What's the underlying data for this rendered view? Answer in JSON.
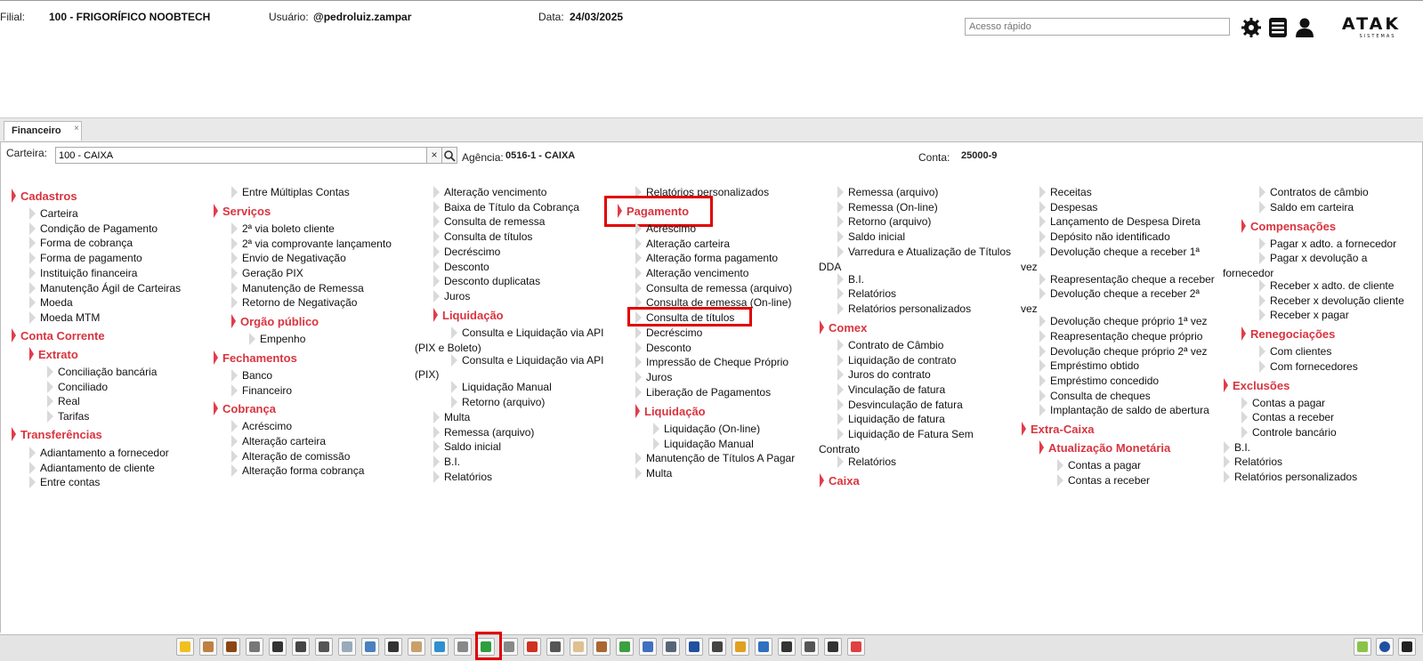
{
  "header": {
    "filial_label": "Filial:",
    "filial_value": "100 - FRIGORÍFICO NOOBTECH",
    "usuario_label": "Usuário:",
    "usuario_value": "@pedroluiz.zampar",
    "data_label": "Data:",
    "data_value": "24/03/2025",
    "quick_access_placeholder": "Acesso rápido",
    "logo_text": "ATAK",
    "logo_subtext": "SISTEMAS"
  },
  "tab": {
    "label": "Financeiro",
    "close": "×"
  },
  "filters": {
    "carteira_label": "Carteira:",
    "carteira_value": "100 - CAIXA",
    "clear": "×",
    "agencia_label": "Agência:",
    "agencia_value": "0516-1 - CAIXA",
    "conta_label": "Conta:",
    "conta_value": "25000-9"
  },
  "col1": {
    "cadastros": "Cadastros",
    "cadastros_items": [
      "Carteira",
      "Condição de Pagamento",
      "Forma de cobrança",
      "Forma de pagamento",
      "Instituição financeira",
      "Manutenção Ágil de Carteiras",
      "Moeda",
      "Moeda MTM"
    ],
    "conta_corrente": "Conta Corrente",
    "extrato": "Extrato",
    "extrato_items": [
      "Conciliação bancária",
      "Conciliado",
      "Real",
      "Tarifas"
    ],
    "transferencias": "Transferências",
    "transferencias_items": [
      "Adiantamento a fornecedor",
      "Adiantamento de cliente",
      "Entre contas"
    ]
  },
  "col2": {
    "top_item": "Entre Múltiplas Contas",
    "servicos": "Serviços",
    "servicos_items": [
      "2ª via boleto cliente",
      "2ª via comprovante lançamento",
      "Envio de Negativação",
      "Geração PIX",
      "Manutenção de Remessa",
      "Retorno de Negativação"
    ],
    "orgao_publico": "Orgão público",
    "orgao_items": [
      "Empenho"
    ],
    "fechamentos": "Fechamentos",
    "fechamentos_items": [
      "Banco",
      "Financeiro"
    ],
    "cobranca": "Cobrança",
    "cobranca_items": [
      "Acréscimo",
      "Alteração carteira",
      "Alteração de comissão",
      "Alteração forma cobrança"
    ]
  },
  "col3": {
    "items_top": [
      "Alteração vencimento",
      "Baixa de Título da Cobrança",
      "Consulta de remessa",
      "Consulta de títulos",
      "Decréscimo",
      "Desconto",
      "Desconto duplicatas",
      "Juros"
    ],
    "liquidacao": "Liquidação",
    "liq_api_pix_1": "Consulta e Liquidação via API",
    "liq_api_pix_2": "(PIX e Boleto)",
    "liq_api_1": "Consulta e Liquidação via API",
    "liq_api_2": "(PIX)",
    "liq_items": [
      "Liquidação Manual",
      "Retorno (arquivo)"
    ],
    "items_bottom": [
      "Multa",
      "Remessa (arquivo)",
      "Saldo inicial",
      "B.I.",
      "Relatórios"
    ]
  },
  "col4": {
    "top_item": "Relatórios personalizados",
    "pagamento": "Pagamento",
    "pagamento_items": [
      "Acréscimo",
      "Alteração carteira",
      "Alteração forma pagamento",
      "Alteração vencimento",
      "Consulta de remessa (arquivo)",
      "Consulta de remessa (On-line)",
      "Consulta de títulos",
      "Decréscimo",
      "Desconto",
      "Impressão de Cheque Próprio",
      "Juros",
      "Liberação de Pagamentos"
    ],
    "liquidacao": "Liquidação",
    "liq_items": [
      "Liquidação (On-line)",
      "Liquidação Manual"
    ],
    "bottom_items": [
      "Manutenção de Títulos A Pagar",
      "Multa"
    ]
  },
  "col5": {
    "items_top": [
      "Remessa (arquivo)",
      "Remessa (On-line)",
      "Retorno (arquivo)",
      "Saldo inicial"
    ],
    "varredura_1": "Varredura e Atualização de Títulos",
    "varredura_2": "DDA",
    "items_mid": [
      "B.I.",
      "Relatórios",
      "Relatórios personalizados"
    ],
    "comex": "Comex",
    "comex_items": [
      "Contrato de Câmbio",
      "Liquidação de contrato",
      "Juros do contrato",
      "Vinculação de fatura",
      "Desvinculação de fatura",
      "Liquidação de fatura"
    ],
    "liq_sem_1": "Liquidação de Fatura Sem",
    "liq_sem_2": "Contrato",
    "comex_last": "Relatórios",
    "caixa": "Caixa"
  },
  "col6": {
    "items_top": [
      "Receitas",
      "Despesas",
      "Lançamento de Despesa Direta",
      "Depósito não identificado"
    ],
    "dev1_1": "Devolução cheque a receber 1ª",
    "dev1_2": "vez",
    "reap": "Reapresentação cheque a receber",
    "dev2_1": "Devolução cheque a receber 2ª",
    "dev2_2": "vez",
    "items_mid": [
      "Devolução cheque próprio 1ª vez",
      "Reapresentação cheque próprio",
      "Devolução cheque próprio 2ª vez",
      "Empréstimo obtido",
      "Empréstimo concedido",
      "Consulta de cheques",
      "Implantação de saldo de abertura"
    ],
    "extra_caixa": "Extra-Caixa",
    "atualizacao": "Atualização Monetária",
    "atualizacao_items": [
      "Contas a pagar",
      "Contas a receber"
    ]
  },
  "col7": {
    "items_top": [
      "Contratos de câmbio",
      "Saldo em carteira"
    ],
    "compensacoes": "Compensações",
    "comp_1": "Pagar x adto. a fornecedor",
    "comp_2a": "Pagar x devolução a",
    "comp_2b": "fornecedor",
    "comp_rest": [
      "Receber x adto. de cliente",
      "Receber x devolução cliente",
      "Receber x pagar"
    ],
    "renegociacoes": "Renegociações",
    "reneg_items": [
      "Com clientes",
      "Com fornecedores"
    ],
    "exclusoes": "Exclusões",
    "excl_items": [
      "Contas a pagar",
      "Contas a receber",
      "Controle bancário"
    ],
    "bottom_items": [
      "B.I.",
      "Relatórios",
      "Relatórios personalizados"
    ]
  },
  "toolbar": {
    "icons": [
      "favorites-icon",
      "people-icon",
      "briefcase-icon",
      "calculator-icon",
      "barcode-icon",
      "cattle-icon",
      "scale-icon",
      "syringe-icon",
      "printer-doc-icon",
      "book-icon",
      "pallet-icon",
      "globe-icon",
      "cylinder-icon",
      "money-icon",
      "printer-icon",
      "factory-icon",
      "building-icon",
      "bottle-icon",
      "truck-icon",
      "recycle-icon",
      "checklist-icon",
      "spreadsheet-icon",
      "network-icon",
      "sequence-icon",
      "invoice-icon",
      "chart-icon",
      "cart-icon",
      "org-chart-icon",
      "headset-icon",
      "palette-icon"
    ],
    "colors": [
      "#f0c020",
      "#c08040",
      "#8b4513",
      "#777777",
      "#333333",
      "#444444",
      "#555555",
      "#99aabb",
      "#4a7fc0",
      "#333333",
      "#c9a06a",
      "#2f8fd0",
      "#888888",
      "#2e9e3e",
      "#888888",
      "#d03020",
      "#555555",
      "#e0c090",
      "#aa6633",
      "#3aa040",
      "#4070c0",
      "#556677",
      "#2050a0",
      "#444444",
      "#e0a020",
      "#3070c0",
      "#333333",
      "#555555",
      "#333333",
      "#e04040"
    ]
  },
  "colors": {
    "accent": "#d9343f",
    "highlight_box": "#e00000"
  }
}
